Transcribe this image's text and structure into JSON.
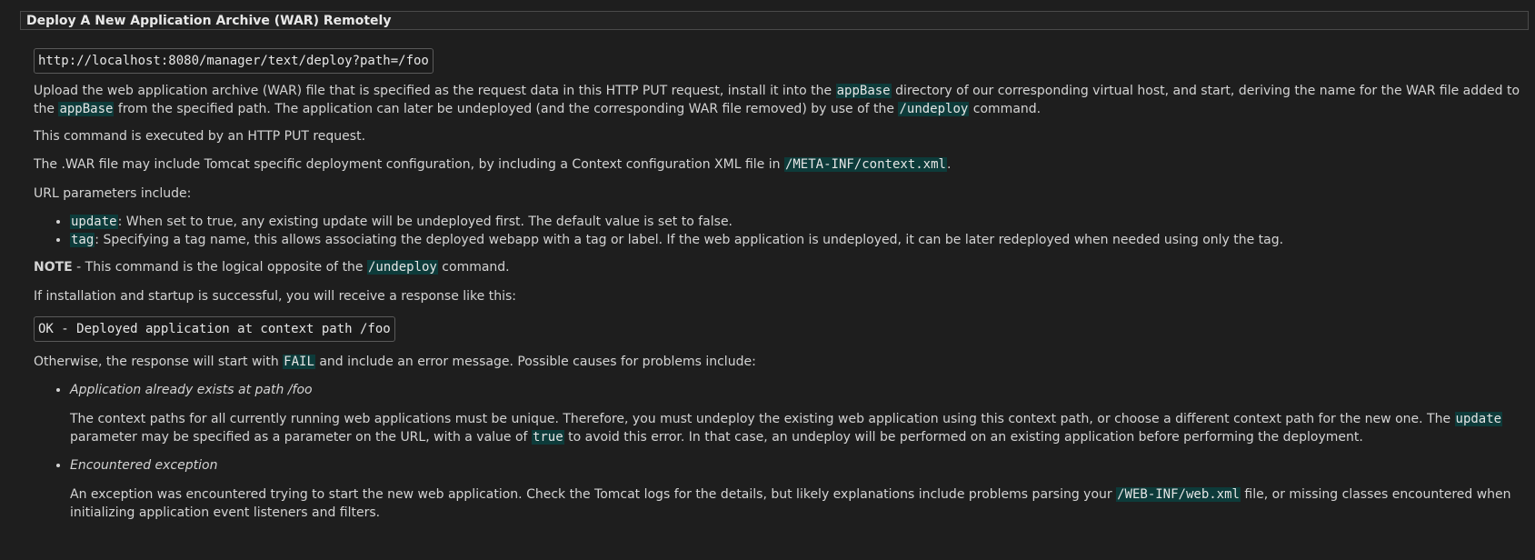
{
  "section": {
    "title": "Deploy A New Application Archive (WAR) Remotely"
  },
  "url_example": "http://localhost:8080/manager/text/deploy?path=/foo",
  "para1": {
    "t1": "Upload the web application archive (WAR) file that is specified as the request data in this HTTP PUT request, install it into the ",
    "c1": "appBase",
    "t2": " directory of our corresponding virtual host, and start, deriving the name for the WAR file added to the ",
    "c2": "appBase",
    "t3": " from the specified path. The application can later be undeployed (and the corresponding WAR file removed) by use of the ",
    "c3": "/undeploy",
    "t4": " command."
  },
  "para2": "This command is executed by an HTTP PUT request.",
  "para3": {
    "t1": "The .WAR file may include Tomcat specific deployment configuration, by including a Context configuration XML file in ",
    "c1": "/META-INF/context.xml",
    "t2": "."
  },
  "para4": "URL parameters include:",
  "params": [
    {
      "code": "update",
      "text": ": When set to true, any existing update will be undeployed first. The default value is set to false."
    },
    {
      "code": "tag",
      "text": ": Specifying a tag name, this allows associating the deployed webapp with a tag or label. If the web application is undeployed, it can be later redeployed when needed using only the tag."
    }
  ],
  "note": {
    "label": "NOTE",
    "t1": " - This command is the logical opposite of the ",
    "c1": "/undeploy",
    "t2": " command."
  },
  "para5": "If installation and startup is successful, you will receive a response like this:",
  "response_example": "OK - Deployed application at context path /foo",
  "para6": {
    "t1": "Otherwise, the response will start with ",
    "c1": "FAIL",
    "t2": " and include an error message. Possible causes for problems include:"
  },
  "causes": [
    {
      "title": "Application already exists at path /foo",
      "t1": "The context paths for all currently running web applications must be unique. Therefore, you must undeploy the existing web application using this context path, or choose a different context path for the new one. The ",
      "c1": "update",
      "t2": " parameter may be specified as a parameter on the URL, with a value of ",
      "c2": "true",
      "t3": " to avoid this error. In that case, an undeploy will be performed on an existing application before performing the deployment."
    },
    {
      "title": "Encountered exception",
      "t1": "An exception was encountered trying to start the new web application. Check the Tomcat logs for the details, but likely explanations include problems parsing your ",
      "c1": "/WEB-INF/web.xml",
      "t2": " file, or missing classes encountered when initializing application event listeners and filters."
    }
  ]
}
